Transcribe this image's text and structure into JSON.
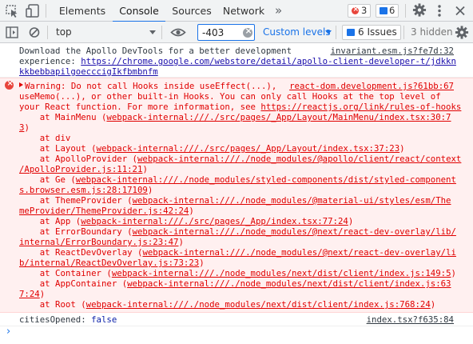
{
  "tabs": {
    "items": [
      {
        "label": "Elements"
      },
      {
        "label": "Console"
      },
      {
        "label": "Sources"
      },
      {
        "label": "Network"
      }
    ],
    "more": "»",
    "errors_count": "3",
    "issues_count": "6"
  },
  "toolbar": {
    "context": "top",
    "filter_value": "-403",
    "levels": "Custom levels",
    "issues": "6 Issues",
    "hidden": "3 hidden"
  },
  "log": {
    "info": {
      "lines": [
        "Download the Apollo DevTools for a better development",
        "experience: ",
        "kkbebbapilgoecccigIkfbmbnfm"
      ],
      "url_part1": "https://chrome.google.com/webstore/detail/apollo-client-developer-t/jdkkn",
      "source": "invariant.esm.js?fe7d:32"
    },
    "error": {
      "warning": "Warning: Do not call Hooks inside useEffect(...), ",
      "line2": "useMemo(...), or other built-in Hooks. You can only call Hooks at the top level of",
      "line3": "your React function. For more information, see ",
      "link": "https://reactjs.org/link/rules-of-hooks",
      "source": "react-dom.development.js?61bb:67",
      "stack": [
        {
          "pre": "    at MainMenu (",
          "link": "webpack-internal:///./src/pages/_App/Layout/MainMenu/index.tsx:30:7",
          "cont": "3",
          "post": ")"
        },
        {
          "pre": "    at div",
          "link": "",
          "cont": "",
          "post": ""
        },
        {
          "pre": "    at Layout (",
          "link": "webpack-internal:///./src/pages/_App/Layout/index.tsx:37:23",
          "cont": "",
          "post": ")"
        },
        {
          "pre": "    at ApolloProvider (",
          "link": "webpack-internal:///./node_modules/@apollo/client/react/context",
          "cont": "/ApolloProvider.js:11:21",
          "post": ")"
        },
        {
          "pre": "    at Ge (",
          "link": "webpack-internal:///./node_modules/styled-components/dist/styled-component",
          "cont": "s.browser.esm.js:28:17109",
          "post": ")"
        },
        {
          "pre": "    at ThemeProvider (",
          "link": "webpack-internal:///./node_modules/@material-ui/styles/esm/The",
          "cont": "meProvider/ThemeProvider.js:42:24",
          "post": ")"
        },
        {
          "pre": "    at App (",
          "link": "webpack-internal:///./src/pages/_App/index.tsx:77:24",
          "cont": "",
          "post": ")"
        },
        {
          "pre": "    at ErrorBoundary (",
          "link": "webpack-internal:///./node_modules/@next/react-dev-overlay/lib/",
          "cont": "internal/ErrorBoundary.js:23:47",
          "post": ")"
        },
        {
          "pre": "    at ReactDevOverlay (",
          "link": "webpack-internal:///./node_modules/@next/react-dev-overlay/li",
          "cont": "b/internal/ReactDevOverlay.js:73:23",
          "post": ")"
        },
        {
          "pre": "    at Container (",
          "link": "webpack-internal:///./node_modules/next/dist/client/index.js:149:5",
          "cont": "",
          "post": ")"
        },
        {
          "pre": "    at AppContainer (",
          "link": "webpack-internal:///./node_modules/next/dist/client/index.js:63",
          "cont": "7:24",
          "post": ")"
        },
        {
          "pre": "    at Root (",
          "link": "webpack-internal:///./node_modules/next/dist/client/index.js:768:24",
          "cont": "",
          "post": ")"
        }
      ]
    },
    "cities": {
      "label": "citiesOpened: ",
      "value": "false",
      "source": "index.tsx?f635:84"
    },
    "prompt": "›"
  }
}
